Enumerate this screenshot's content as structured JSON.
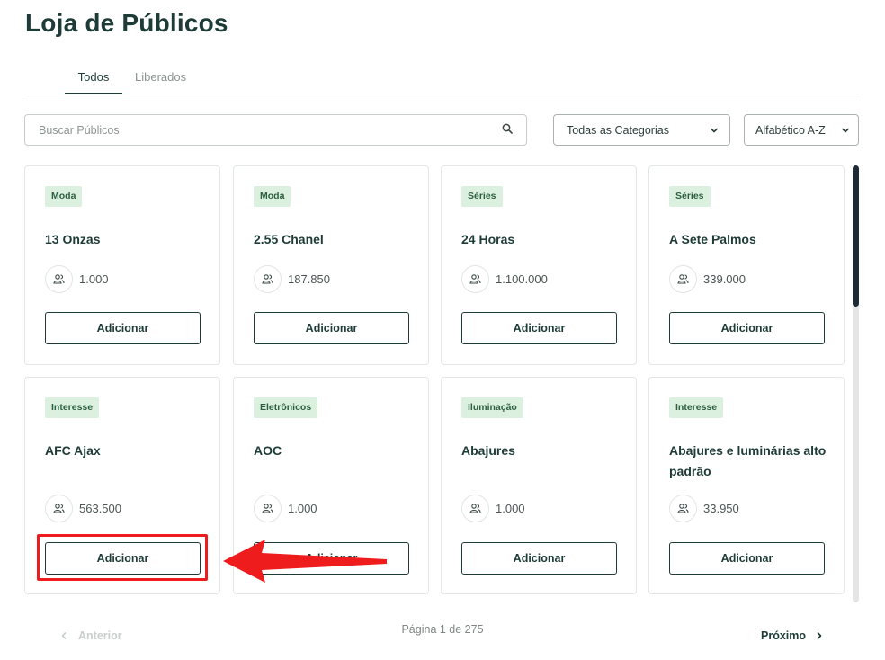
{
  "page": {
    "title": "Loja de Públicos"
  },
  "tabs": [
    {
      "label": "Todos",
      "active": true
    },
    {
      "label": "Liberados",
      "active": false
    }
  ],
  "search": {
    "placeholder": "Buscar Públicos",
    "value": ""
  },
  "filters": {
    "category": "Todas as Categorias",
    "sort": "Alfabético A-Z"
  },
  "cards": [
    {
      "badge": "Moda",
      "title": "13 Onzas",
      "count": "1.000",
      "button": "Adicionar"
    },
    {
      "badge": "Moda",
      "title": "2.55 Chanel",
      "count": "187.850",
      "button": "Adicionar"
    },
    {
      "badge": "Séries",
      "title": "24 Horas",
      "count": "1.100.000",
      "button": "Adicionar"
    },
    {
      "badge": "Séries",
      "title": "A Sete Palmos",
      "count": "339.000",
      "button": "Adicionar"
    },
    {
      "badge": "Interesse",
      "title": "AFC Ajax",
      "count": "563.500",
      "button": "Adicionar"
    },
    {
      "badge": "Eletrônicos",
      "title": "AOC",
      "count": "1.000",
      "button": "Adicionar"
    },
    {
      "badge": "Iluminação",
      "title": "Abajures",
      "count": "1.000",
      "button": "Adicionar"
    },
    {
      "badge": "Interesse",
      "title": "Abajures e luminárias alto padrão",
      "count": "33.950",
      "button": "Adicionar"
    }
  ],
  "pagination": {
    "prev": "Anterior",
    "info": "Página 1 de 275",
    "next": "Próximo"
  },
  "colors": {
    "primary": "#1d3b37",
    "badge_bg": "#dcf0e0",
    "annotation": "#ee1c1c"
  }
}
